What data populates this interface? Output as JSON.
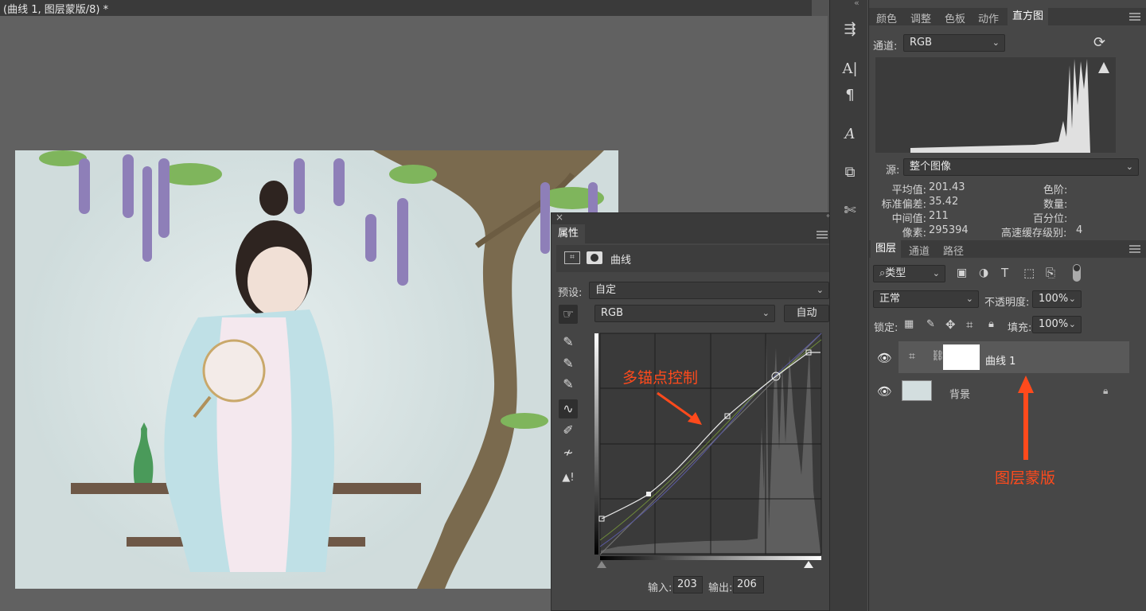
{
  "document": {
    "title": "(曲线 1, 图层蒙版/8) *"
  },
  "histogram_panel": {
    "tabs": [
      "颜色",
      "调整",
      "色板",
      "动作",
      "直方图"
    ],
    "active_tab": "直方图",
    "channel_label": "通道:",
    "channel_value": "RGB",
    "source_label": "源:",
    "source_value": "整个图像",
    "stats": {
      "mean_label": "平均值:",
      "mean": "201.43",
      "std_label": "标准偏差:",
      "std": "35.42",
      "median_label": "中间值:",
      "median": "211",
      "pixels_label": "像素:",
      "pixels": "295394",
      "level_label": "色阶:",
      "count_label": "数量:",
      "percentile_label": "百分位:",
      "cache_label": "高速缓存级别:",
      "cache": "4"
    }
  },
  "layers_panel": {
    "tabs": [
      "图层",
      "通道",
      "路径"
    ],
    "active_tab": "图层",
    "filter_value": "类型",
    "blend_mode": "正常",
    "opacity_label": "不透明度:",
    "opacity": "100%",
    "lock_label": "锁定:",
    "fill_label": "填充:",
    "fill": "100%",
    "layers": [
      {
        "name": "曲线 1",
        "selected": true
      },
      {
        "name": "背景",
        "selected": false
      }
    ]
  },
  "properties_panel": {
    "title": "属性",
    "adjustment_name": "曲线",
    "preset_label": "预设:",
    "preset_value": "自定",
    "channel_value": "RGB",
    "auto_button": "自动",
    "input_label": "输入:",
    "input_value": "203",
    "output_label": "输出:",
    "output_value": "206"
  },
  "annotations": {
    "curve_note": "多锚点控制",
    "mask_note": "图层蒙版"
  },
  "colors": {
    "annotation": "#ff4a1c",
    "panel_bg": "#474747",
    "canvas_bg": "#616161"
  }
}
